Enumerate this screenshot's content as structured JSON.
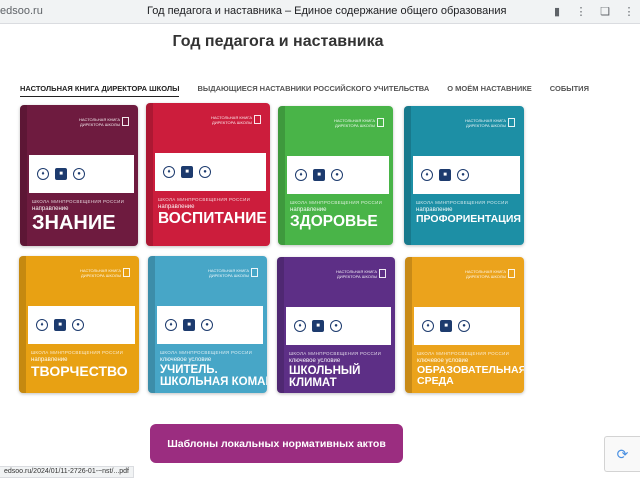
{
  "browser": {
    "url": "edsoo.ru",
    "tab_title": "Год педагога и наставника – Единое содержание общего образования",
    "icons": [
      "bookmark-icon",
      "more-icon",
      "extension-icon",
      "menu-icon"
    ]
  },
  "page": {
    "title": "Год педагога и наставника"
  },
  "tabs": [
    {
      "label": "НАСТОЛЬНАЯ КНИГА ДИРЕКТОРА ШКОЛЫ",
      "active": true
    },
    {
      "label": "ВЫДАЮЩИЕСЯ НАСТАВНИКИ РОССИЙСКОГО УЧИТЕЛЬСТВА",
      "active": false
    },
    {
      "label": "О МОЁМ НАСТАВНИКЕ",
      "active": false
    },
    {
      "label": "СОБЫТИЯ",
      "active": false
    }
  ],
  "books": [
    {
      "series": "НАСТОЛЬНАЯ КНИГА ДИРЕКТОРА ШКОЛЫ",
      "school": "ШКОЛА МИНПРОСВЕЩЕНИЯ РОССИИ",
      "kind": "направление",
      "title": "ЗНАНИЕ",
      "color": "#6e1b3f"
    },
    {
      "series": "НАСТОЛЬНАЯ КНИГА ДИРЕКТОРА ШКОЛЫ",
      "school": "ШКОЛА МИНПРОСВЕЩЕНИЯ РОССИИ",
      "kind": "направление",
      "title": "ВОСПИТАНИЕ",
      "color": "#cc1d3c"
    },
    {
      "series": "НАСТОЛЬНАЯ КНИГА ДИРЕКТОРА ШКОЛЫ",
      "school": "ШКОЛА МИНПРОСВЕЩЕНИЯ РОССИИ",
      "kind": "направление",
      "title": "ЗДОРОВЬЕ",
      "color": "#49b448"
    },
    {
      "series": "НАСТОЛЬНАЯ КНИГА ДИРЕКТОРА ШКОЛЫ",
      "school": "ШКОЛА МИНПРОСВЕЩЕНИЯ РОССИИ",
      "kind": "направление",
      "title": "ПРОФОРИЕНТАЦИЯ",
      "color": "#1d8fa5"
    },
    {
      "series": "НАСТОЛЬНАЯ КНИГА ДИРЕКТОРА ШКОЛЫ",
      "school": "ШКОЛА МИНПРОСВЕЩЕНИЯ РОССИИ",
      "kind": "направление",
      "title": "ТВОРЧЕСТВО",
      "color": "#e8a113"
    },
    {
      "series": "НАСТОЛЬНАЯ КНИГА ДИРЕКТОРА ШКОЛЫ",
      "school": "ШКОЛА МИНПРОСВЕЩЕНИЯ РОССИИ",
      "kind": "ключевое условие",
      "title": "УЧИТЕЛЬ.\nШКОЛЬНАЯ КОМАНДА",
      "color": "#47a6c7"
    },
    {
      "series": "НАСТОЛЬНАЯ КНИГА ДИРЕКТОРА ШКОЛЫ",
      "school": "ШКОЛА МИНПРОСВЕЩЕНИЯ РОССИИ",
      "kind": "ключевое условие",
      "title": "ШКОЛЬНЫЙ\nКЛИМАТ",
      "color": "#5d2f86"
    },
    {
      "series": "НАСТОЛЬНАЯ КНИГА ДИРЕКТОРА ШКОЛЫ",
      "school": "ШКОЛА МИНПРОСВЕЩЕНИЯ РОССИИ",
      "kind": "ключевое условие",
      "title": "ОБРАЗОВАТЕЛЬНАЯ\nСРЕДА",
      "color": "#eba31c"
    }
  ],
  "cta": {
    "label": "Шаблоны локальных нормативных актов"
  },
  "status": {
    "link": "edsoo.ru/2024/01/11-2726-01-~nst/...pdf"
  }
}
